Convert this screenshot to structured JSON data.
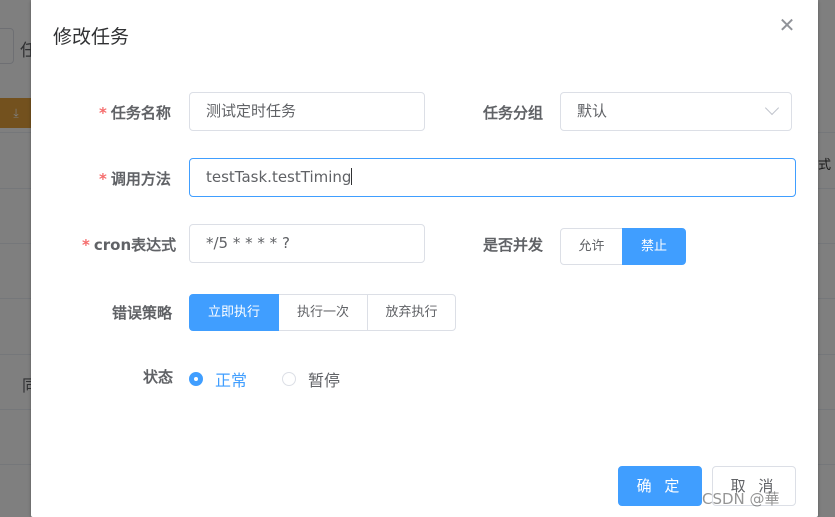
{
  "background": {
    "left_text": "任",
    "right_col_text": "式",
    "left_row_char": "同"
  },
  "dialog": {
    "title": "修改任务",
    "close_icon": "close-icon"
  },
  "form": {
    "task_name": {
      "label": "任务名称",
      "required": "*",
      "value": "测试定时任务"
    },
    "task_group": {
      "label": "任务分组",
      "value": "默认",
      "icon": "chevron-down-icon"
    },
    "invoke_target": {
      "label": "调用方法",
      "required": "*",
      "value": "testTask.testTiming"
    },
    "cron": {
      "label": "cron表达式",
      "required": "*",
      "value": "*/5 * * * * ?"
    },
    "concurrent": {
      "label": "是否并发",
      "options": [
        "允许",
        "禁止"
      ],
      "selected": "禁止"
    },
    "misfire": {
      "label": "错误策略",
      "options": [
        "立即执行",
        "执行一次",
        "放弃执行"
      ],
      "selected": "立即执行"
    },
    "status": {
      "label": "状态",
      "options": [
        "正常",
        "暂停"
      ],
      "selected": "正常"
    }
  },
  "footer": {
    "confirm_label": "确 定",
    "cancel_label": "取 消"
  },
  "watermark": "CSDN @華",
  "colors": {
    "primary": "#409eff",
    "required": "#f56c6c",
    "warning": "#e6a23c"
  }
}
